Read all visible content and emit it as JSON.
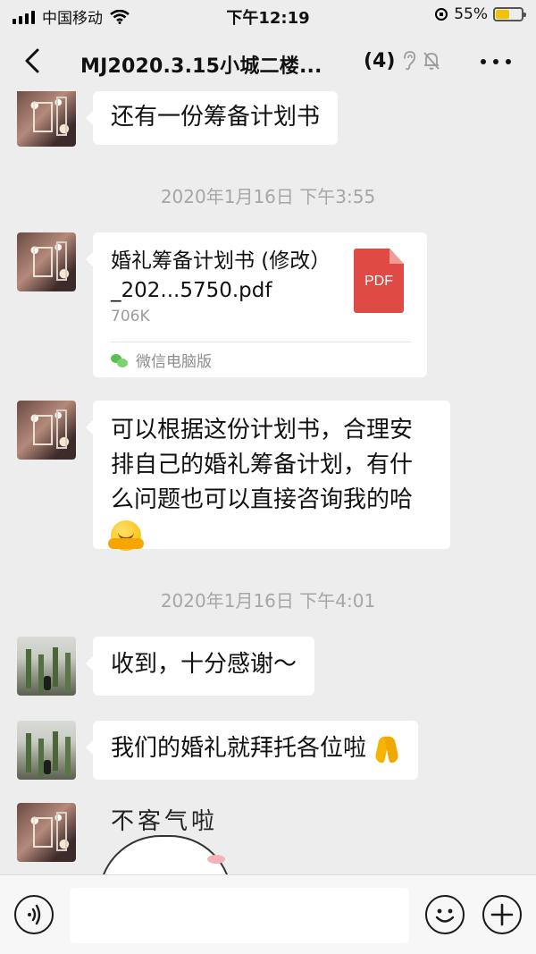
{
  "status_bar": {
    "carrier": "中国移动",
    "time": "下午12:19",
    "battery_percent_label": "55%",
    "battery_level": 0.55,
    "battery_color": "#f5c400"
  },
  "header": {
    "title": "MJ2020.3.15小城二楼...",
    "member_count": "(4)",
    "icons": [
      "back-icon",
      "ear-icon",
      "mute-bell-icon",
      "more-icon"
    ]
  },
  "messages": [
    {
      "type": "text",
      "text": "还有一份筹备计划书"
    },
    {
      "type": "timestamp",
      "text": "2020年1月16日 下午3:55"
    },
    {
      "type": "file",
      "name": "婚礼筹备计划书 (修改）_202...5750.pdf",
      "size": "706K",
      "icon_label": "PDF",
      "source": "微信电脑版"
    },
    {
      "type": "text",
      "text": "可以根据这份计划书，合理安排自己的婚礼筹备计划，有什么问题也可以直接咨询我的哈",
      "emoji": "hugging-face-emoji"
    },
    {
      "type": "timestamp",
      "text": "2020年1月16日 下午4:01"
    },
    {
      "type": "text",
      "text": "收到，十分感谢～"
    },
    {
      "type": "text",
      "text": "我们的婚礼就拜托各位啦",
      "emoji": "folded-hands-emoji"
    },
    {
      "type": "sticker",
      "text": "不客气啦"
    }
  ],
  "input_bar": {
    "placeholder": "",
    "icons": [
      "voice-icon",
      "emoji-icon",
      "plus-icon"
    ]
  }
}
